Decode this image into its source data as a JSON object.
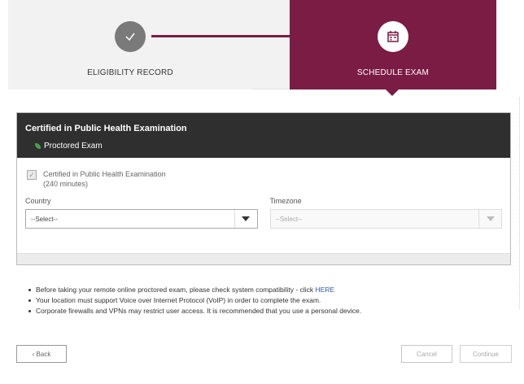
{
  "stepper": {
    "steps": [
      {
        "label": "ELIGIBILITY RECORD",
        "icon": "checkmark-icon",
        "state": "completed"
      },
      {
        "label": "SCHEDULE EXAM",
        "icon": "calendar-icon",
        "state": "active"
      }
    ],
    "colors": {
      "active": "#7b1c45",
      "completed": "#7a7a7a"
    }
  },
  "panel": {
    "title": "Certified in Public Health Examination",
    "subtitle": "Proctored Exam",
    "exam_checkbox_label": "Certified in Public Health Examination (240 minutes)",
    "country": {
      "label": "Country",
      "value": "--Select--"
    },
    "timezone": {
      "label": "Timezone",
      "value": "--Select--"
    }
  },
  "notes": {
    "item1_text": "Before taking your remote online proctored exam, please check system compatibility - click ",
    "item1_link": "HERE",
    "item2": "Your location must support Voice over Internet Protocol (VoIP) in order to complete the exam.",
    "item3": "Corporate firewalls and VPNs may restrict user access. It is recommended that you use a personal device."
  },
  "buttons": {
    "back": "‹ Back",
    "cancel": "Cancel",
    "continue": "Continue"
  }
}
